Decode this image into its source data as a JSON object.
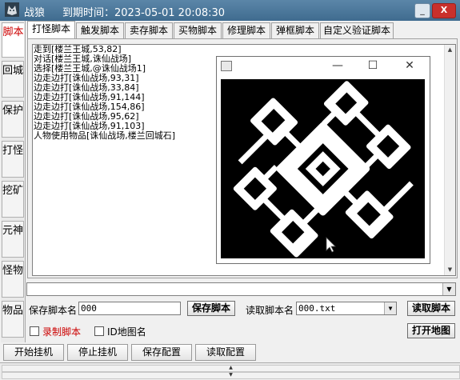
{
  "window": {
    "app_name": "战狼",
    "expire_text": "到期时间：2023-05-01 20:08:30",
    "minimize_glyph": "_",
    "close_glyph": "X"
  },
  "side_nav": [
    "脚本",
    "回城",
    "保护",
    "打怪",
    "挖矿",
    "元神",
    "怪物",
    "物品"
  ],
  "tabs": [
    "打怪脚本",
    "触发脚本",
    "卖存脚本",
    "买物脚本",
    "修理脚本",
    "弹框脚本",
    "自定义验证脚本"
  ],
  "script_lines": [
    "走到[楼兰王城,53,82]",
    "对话[楼兰王城,诛仙战场]",
    "选择[楼兰王城,@诛仙战场1]",
    "边走边打[诛仙战场,93,31]",
    "边走边打[诛仙战场,33,84]",
    "边走边打[诛仙战场,91,144]",
    "边走边打[诛仙战场,154,86]",
    "边走边打[诛仙战场,95,62]",
    "边走边打[诛仙战场,91,103]",
    "人物使用物品[诛仙战场,楼兰回城石]"
  ],
  "map_window": {
    "controls": [
      "—",
      "☐",
      "✕"
    ]
  },
  "save_row": {
    "save_label": "保存脚本名",
    "save_value": "000",
    "save_button": "保存脚本",
    "read_label": "读取脚本名",
    "read_value": "000.txt",
    "read_button": "读取脚本"
  },
  "options": {
    "record_label": "录制脚本",
    "idmap_label": "ID地图名",
    "open_map_button": "打开地图"
  },
  "bottom_buttons": [
    "开始挂机",
    "停止挂机",
    "保存配置",
    "读取配置"
  ],
  "icons": {
    "logo": "wolf-logo-icon",
    "dropdown": "chevron-down-icon"
  },
  "colors": {
    "titlebar": "#4a7699",
    "record_label": "#cc0000",
    "active_nav": "#cc0000"
  }
}
